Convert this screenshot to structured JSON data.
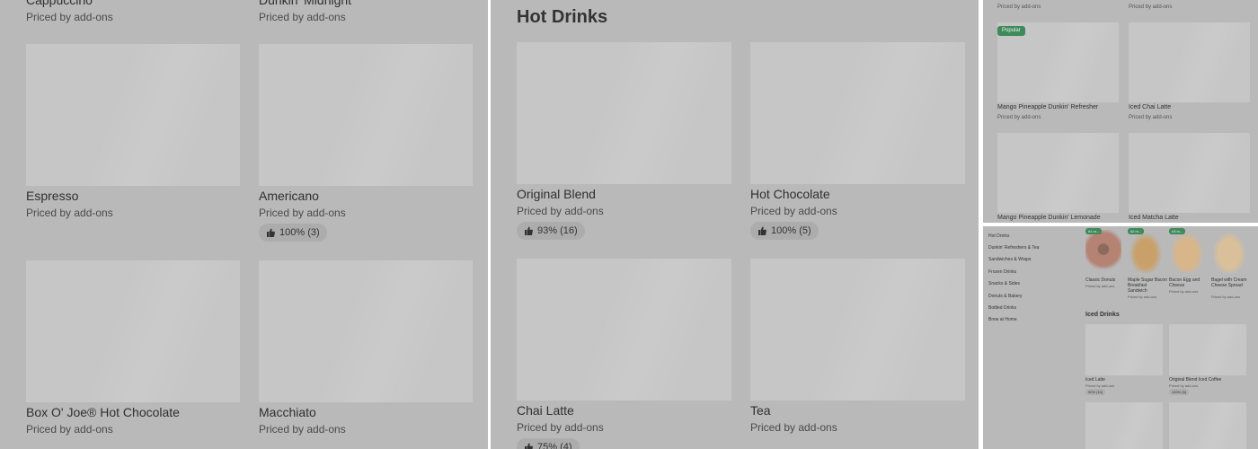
{
  "panel1": {
    "top_items": [
      {
        "title": "Cappuccino",
        "sub": "Priced by add-ons"
      },
      {
        "title": "Dunkin' Midnight",
        "sub": "Priced by add-ons"
      }
    ],
    "items": [
      {
        "title": "Espresso",
        "sub": "Priced by add-ons"
      },
      {
        "title": "Americano",
        "sub": "Priced by add-ons",
        "rating": "100% (3)"
      },
      {
        "title": "Box O' Joe® Hot Chocolate",
        "sub": "Priced by add-ons"
      },
      {
        "title": "Macchiato",
        "sub": "Priced by add-ons"
      }
    ]
  },
  "panel2": {
    "heading": "Hot Drinks",
    "items": [
      {
        "title": "Original Blend",
        "sub": "Priced by add-ons",
        "rating": "93% (16)"
      },
      {
        "title": "Hot Chocolate",
        "sub": "Priced by add-ons",
        "rating": "100% (5)"
      },
      {
        "title": "Chai Latte",
        "sub": "Priced by add-ons",
        "rating": "75% (4)"
      },
      {
        "title": "Tea",
        "sub": "Priced by add-ons"
      }
    ]
  },
  "panel3": {
    "top_subs": [
      "Priced by add-ons",
      "Priced by add-ons"
    ],
    "badge": "Popular",
    "items": [
      {
        "title": "Mango Pineapple Dunkin' Refresher",
        "sub": "Priced by add-ons"
      },
      {
        "title": "Iced Chai Latte",
        "sub": "Priced by add-ons"
      },
      {
        "title": "Mango Pineapple Dunkin' Lemonade"
      },
      {
        "title": "Iced Matcha Latte"
      }
    ]
  },
  "panel4": {
    "nav": [
      "Hot Drinks",
      "Dunkin' Refreshers & Tea",
      "Sandwiches & Wraps",
      "Frozen Drinks",
      "Snacks & Sides",
      "Donuts & Bakery",
      "Bottled Drinks",
      "Brew at Home"
    ],
    "top_items": [
      {
        "title": "Classic Donuts",
        "sub": "Priced by add-ons",
        "badge": "#1 m..."
      },
      {
        "title": "Maple Sugar Bacon Breakfast Sandwich",
        "sub": "Priced by add-ons",
        "badge": "#2 m..."
      },
      {
        "title": "Bacon Egg and Cheese",
        "sub": "Priced by add-ons",
        "badge": "#3 m..."
      },
      {
        "title": "Bagel with Cream Cheese Spread",
        "sub": "Priced by add-ons",
        "badge": "#4 m..."
      }
    ],
    "heading": "Iced Drinks",
    "items": [
      {
        "title": "Iced Latte",
        "sub": "Priced by add-ons",
        "rating": "90% (10)"
      },
      {
        "title": "Original Blend Iced Coffee",
        "sub": "Priced by add-ons",
        "rating": "100% (5)"
      }
    ]
  },
  "colors": {
    "overlay": "#b9b9b9",
    "placeholder": "#c6c6c6",
    "badge": "#3f8a5a"
  }
}
